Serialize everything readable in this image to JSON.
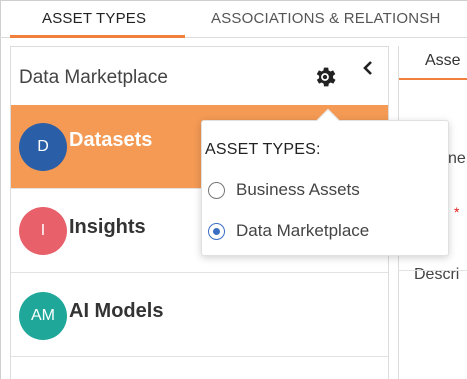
{
  "tabs": [
    {
      "label": "ASSET TYPES",
      "active": true
    },
    {
      "label": "ASSOCIATIONS & RELATIONSH",
      "active": false
    }
  ],
  "panel": {
    "title": "Data Marketplace",
    "gear_icon": "gear-icon",
    "collapse_icon": "chevron-left-icon",
    "items": [
      {
        "initials": "D",
        "label": "Datasets",
        "avatar_color": "#2a5fa8",
        "active": true
      },
      {
        "initials": "I",
        "label": "Insights",
        "avatar_color": "#e8606a",
        "active": false
      },
      {
        "initials": "AM",
        "label": "AI Models",
        "avatar_color": "#1fa89a",
        "active": false
      }
    ]
  },
  "popover": {
    "title": "ASSET TYPES:",
    "options": [
      {
        "label": "Business Assets",
        "selected": false
      },
      {
        "label": "Data Marketplace",
        "selected": true
      }
    ]
  },
  "right": {
    "tab_label": "Asse",
    "field_fragment": "ne",
    "required_mark": "*",
    "descr_fragment": "Descri"
  },
  "colors": {
    "accent": "#f0803c",
    "active_row": "#f49a54",
    "radio_selected": "#3a6fc4"
  }
}
